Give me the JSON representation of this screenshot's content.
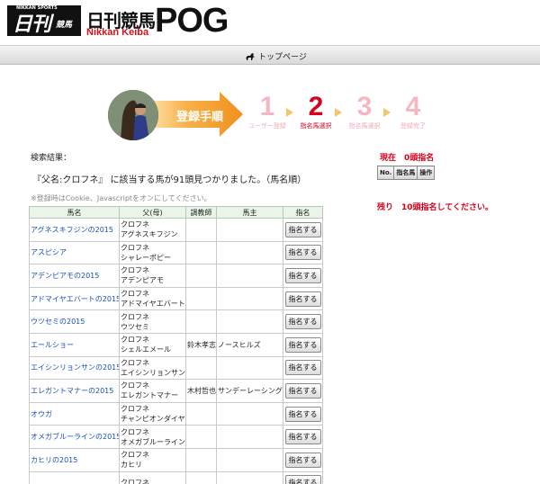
{
  "header": {
    "logo_tiny": "NIKKAN SPORTS",
    "logo_big": "日刊",
    "logo_small": "競馬",
    "title_jp": "日刊競馬",
    "title_en": "Nikkan Keiba",
    "title_pog": "POG"
  },
  "nav": {
    "top_link": "トップページ"
  },
  "steps": {
    "banner": "登録手順",
    "items": [
      {
        "num": "1",
        "label": "ユーザー登録"
      },
      {
        "num": "2",
        "label": "指名馬選択"
      },
      {
        "num": "3",
        "label": "指名馬選択"
      },
      {
        "num": "4",
        "label": "登録完了"
      }
    ]
  },
  "search": {
    "result_label": "検索結果：",
    "found_text": "『父名:クロフネ』 に該当する馬が91頭見つかりました。（馬名順）",
    "note": "※登録時はCookie、Javascriptをオンにしてください。"
  },
  "table": {
    "headers": [
      "馬名",
      "父(母)",
      "調教師",
      "馬主",
      "指名"
    ],
    "button_label": "指名する",
    "rows": [
      {
        "name": "アグネスキフジンの2015",
        "sire": "クロフネ",
        "dam": "アグネスキフジン",
        "trainer": "",
        "owner": ""
      },
      {
        "name": "アスピシア",
        "sire": "クロフネ",
        "dam": "シャレーポピー",
        "trainer": "",
        "owner": ""
      },
      {
        "name": "アデンピアモの2015",
        "sire": "クロフネ",
        "dam": "アデンピアモ",
        "trainer": "",
        "owner": ""
      },
      {
        "name": "アドマイヤエバートの2015",
        "sire": "クロフネ",
        "dam": "アドマイヤエバート",
        "trainer": "",
        "owner": ""
      },
      {
        "name": "ウツセミの2015",
        "sire": "クロフネ",
        "dam": "ウツセミ",
        "trainer": "",
        "owner": ""
      },
      {
        "name": "エールショー",
        "sire": "クロフネ",
        "dam": "シェルエメール",
        "trainer": "鈴木孝志",
        "owner": "ノースヒルズ"
      },
      {
        "name": "エイシンリョンサンの2015",
        "sire": "クロフネ",
        "dam": "エイシンリョンサン",
        "trainer": "",
        "owner": ""
      },
      {
        "name": "エレガントマナーの2015",
        "sire": "クロフネ",
        "dam": "エレガントマナー",
        "trainer": "木村哲也",
        "owner": "サンデーレーシング"
      },
      {
        "name": "オウガ",
        "sire": "クロフネ",
        "dam": "チャンピオンダイヤ",
        "trainer": "",
        "owner": ""
      },
      {
        "name": "オメガブルーラインの2015",
        "sire": "クロフネ",
        "dam": "オメガブルーライン",
        "trainer": "",
        "owner": ""
      },
      {
        "name": "カヒリの2015",
        "sire": "クロフネ",
        "dam": "カヒリ",
        "trainer": "",
        "owner": ""
      },
      {
        "name": "",
        "sire": "クロフネ",
        "dam": "",
        "trainer": "",
        "owner": ""
      }
    ]
  },
  "right": {
    "current": "現在　0頭指名",
    "headers": [
      "No.",
      "指名馬",
      "操作"
    ],
    "remaining": "残り　10頭指名してください。"
  },
  "colors": {
    "accent_red": "#d6001c",
    "link_blue": "#1a4fb5",
    "step_orange": "#f39a2a"
  }
}
